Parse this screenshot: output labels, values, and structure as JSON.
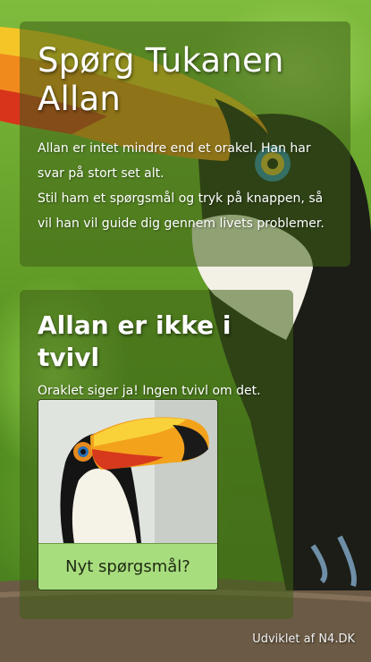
{
  "intro": {
    "title": "Spørg Tukanen Allan",
    "paragraph_1": "Allan er intet mindre end et orakel. Han har svar på stort set alt.",
    "paragraph_2": "Stil ham et spørgsmål og tryk på knappen, så vil han vil guide dig gennem livets problemer."
  },
  "answer": {
    "title": "Allan er ikke i tvivl",
    "text": "Oraklet siger ja! Ingen tvivl om det.",
    "button_label": "Nyt spørgsmål?"
  },
  "footer": {
    "credit": "Udviklet af N4.DK"
  }
}
